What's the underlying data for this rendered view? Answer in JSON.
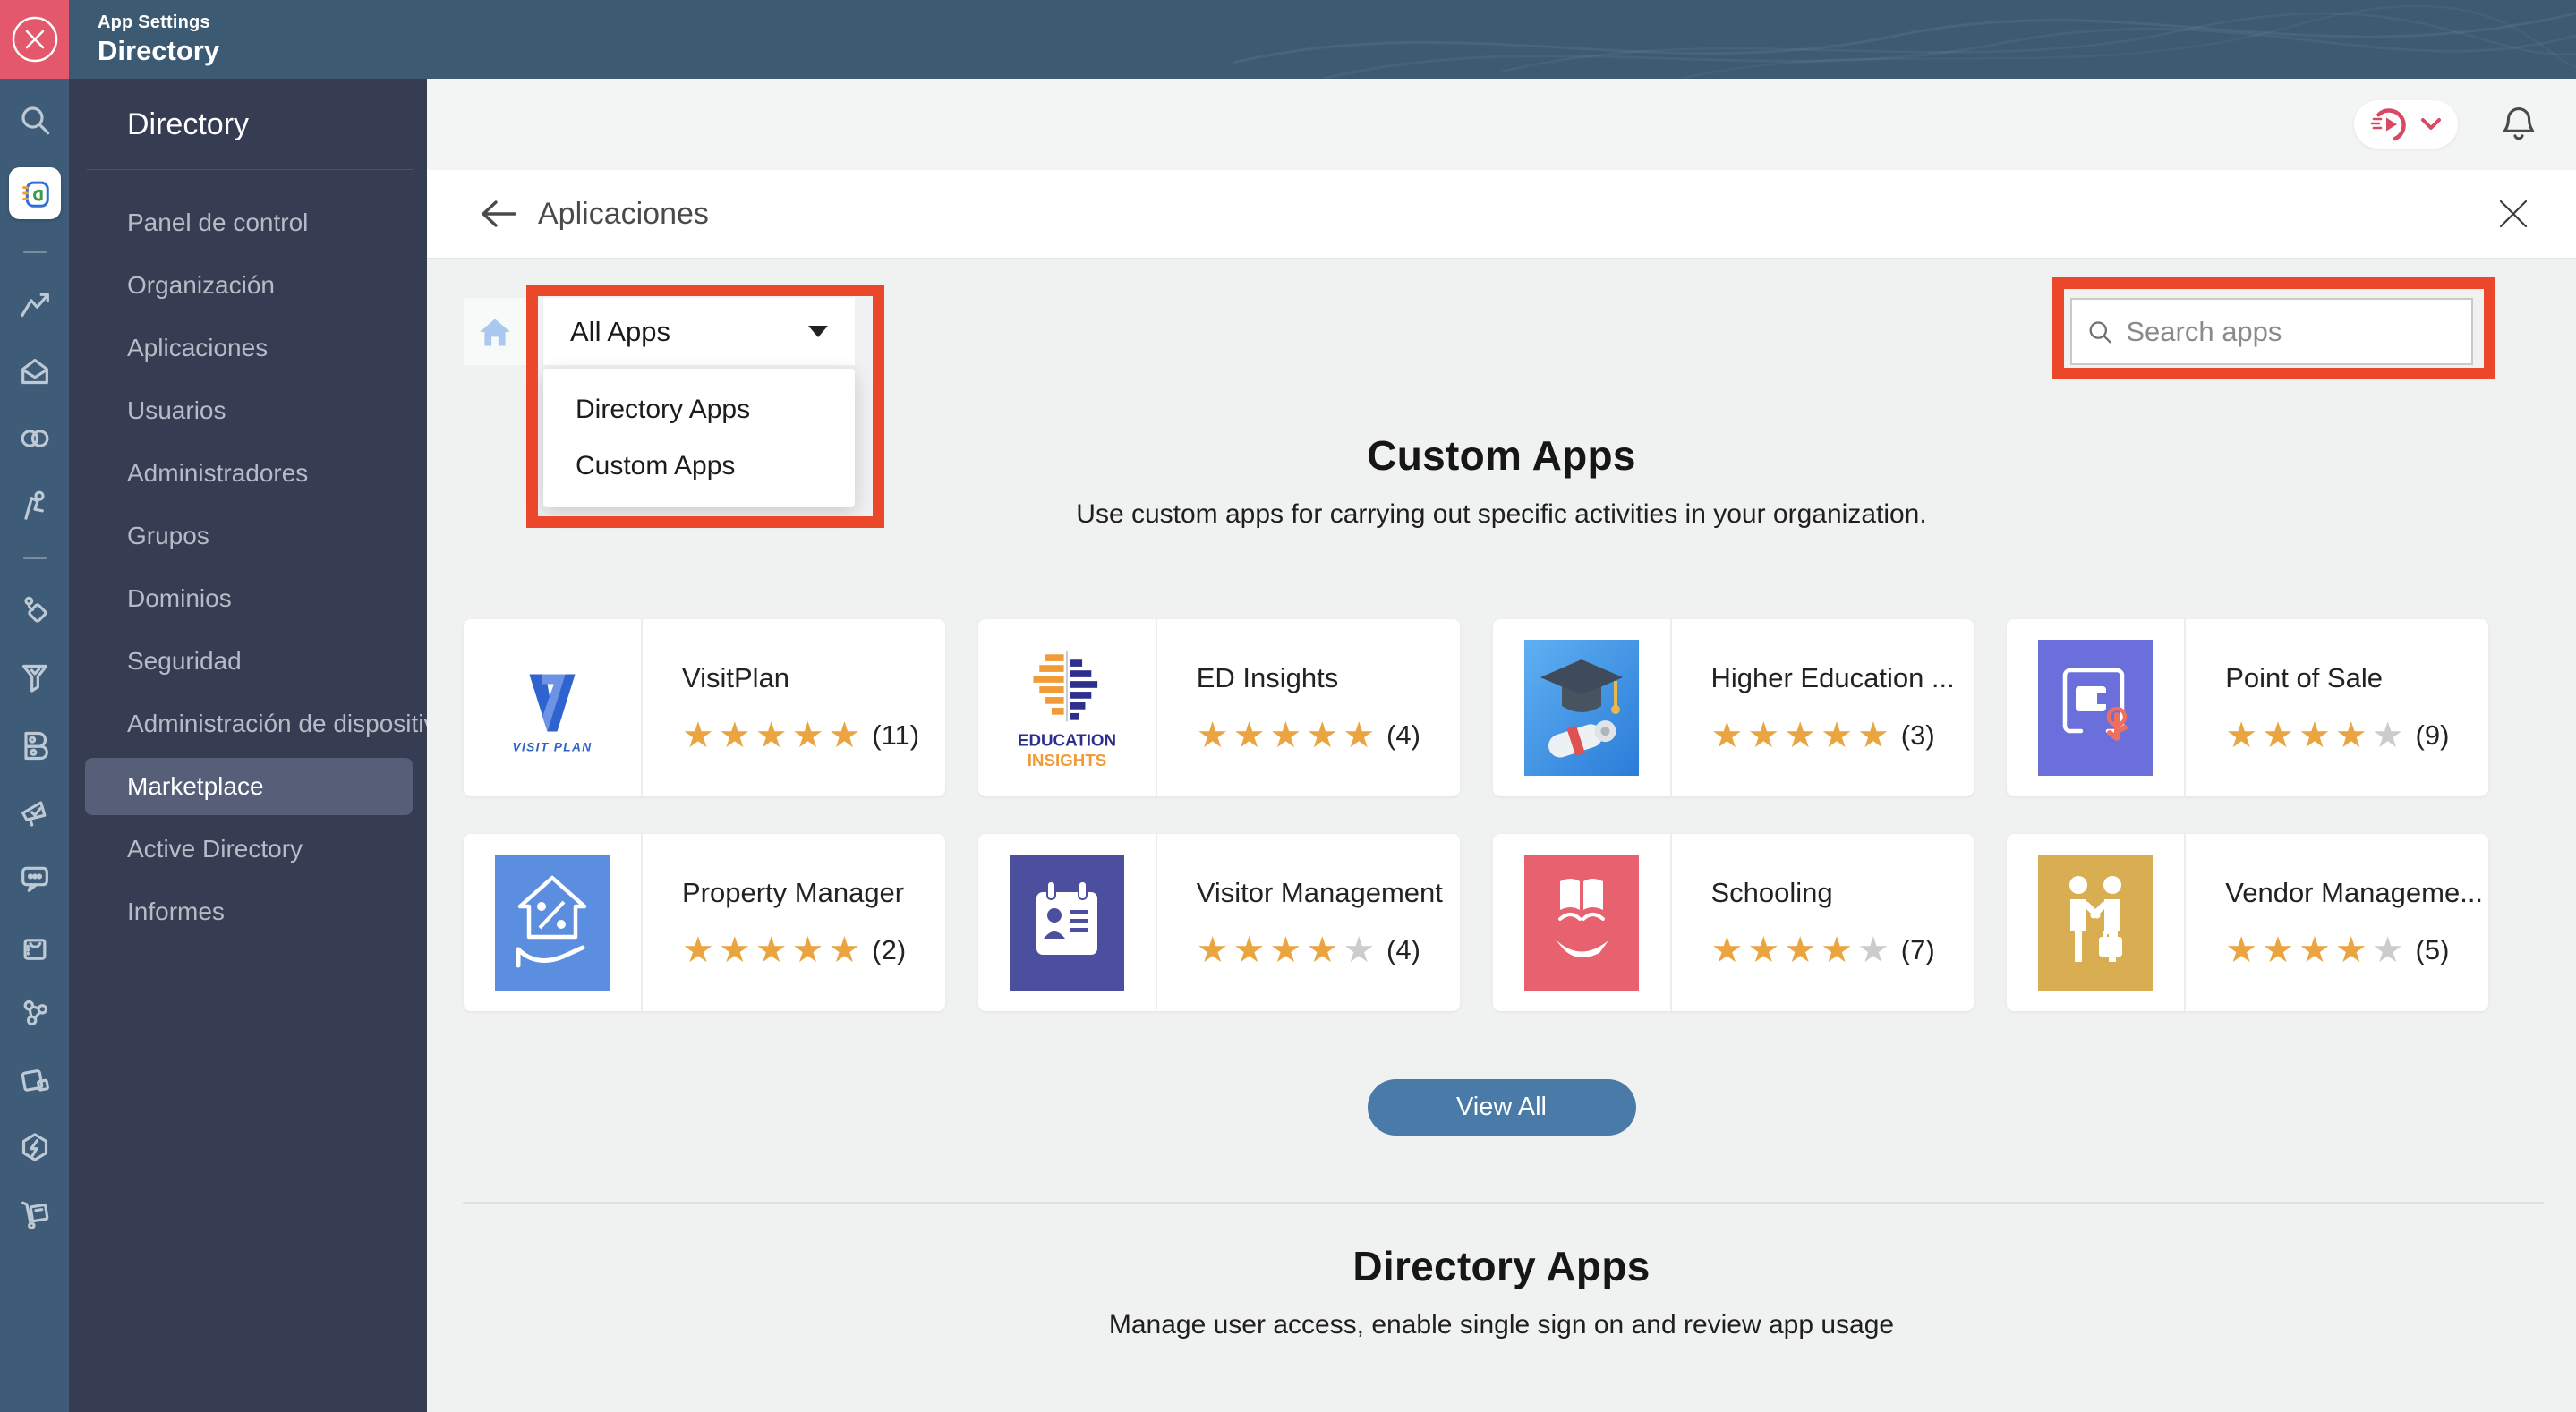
{
  "header": {
    "app_settings_label": "App Settings",
    "product_title": "Directory"
  },
  "sidebar": {
    "title": "Directory",
    "items": [
      "Panel de control",
      "Organización",
      "Aplicaciones",
      "Usuarios",
      "Administradores",
      "Grupos",
      "Dominios",
      "Seguridad",
      "Administración de dispositivos",
      "Marketplace",
      "Active Directory",
      "Informes"
    ],
    "active": "Marketplace"
  },
  "page": {
    "title": "Aplicaciones"
  },
  "apps_filter": {
    "selected": "All Apps",
    "options": [
      "Directory Apps",
      "Custom Apps"
    ]
  },
  "search": {
    "placeholder": "Search apps"
  },
  "sections": {
    "custom_apps": {
      "title": "Custom Apps",
      "subtitle": "Use custom apps for carrying out specific activities in your organization.",
      "view_all_label": "View All"
    },
    "directory_apps": {
      "title": "Directory Apps",
      "subtitle": "Manage user access, enable single sign on and review app usage"
    }
  },
  "apps": [
    {
      "name": "VisitPlan",
      "stars": 5,
      "max_stars": 5,
      "reviews": 11,
      "logo": "visitplan"
    },
    {
      "name": "ED Insights",
      "stars": 5,
      "max_stars": 5,
      "reviews": 4,
      "logo": "edinsights"
    },
    {
      "name": "Higher Education ...",
      "stars": 5,
      "max_stars": 5,
      "reviews": 3,
      "logo": "highered"
    },
    {
      "name": "Point of Sale",
      "stars": 4,
      "max_stars": 5,
      "reviews": 9,
      "logo": "pos"
    },
    {
      "name": "Property Manager",
      "stars": 5,
      "max_stars": 5,
      "reviews": 2,
      "logo": "property"
    },
    {
      "name": "Visitor Management",
      "stars": 4,
      "max_stars": 5,
      "reviews": 4,
      "logo": "visitor"
    },
    {
      "name": "Schooling",
      "stars": 4,
      "max_stars": 5,
      "reviews": 7,
      "logo": "schooling"
    },
    {
      "name": "Vendor Manageme...",
      "stars": 4,
      "max_stars": 5,
      "reviews": 5,
      "logo": "vendor"
    }
  ],
  "rail_icons": [
    "search",
    "directory-app",
    "analytics",
    "mail",
    "link",
    "people",
    "connect",
    "recruit",
    "books",
    "campaigns",
    "cliq",
    "commerce",
    "share",
    "learn",
    "flow",
    "inventory"
  ],
  "other_icons": [
    "close",
    "home",
    "chevron-down",
    "bell",
    "avatar-play",
    "back-arrow",
    "magnifier",
    "caret-down"
  ],
  "colors": {
    "annotation": "#EA472B",
    "star_filled": "#EAA440",
    "star_empty": "#CCCCCC",
    "accent_button": "#4A7AA8",
    "header_slate": "#3D5A73",
    "sidebar": "#363C51",
    "close_tile": "#E4586C"
  }
}
